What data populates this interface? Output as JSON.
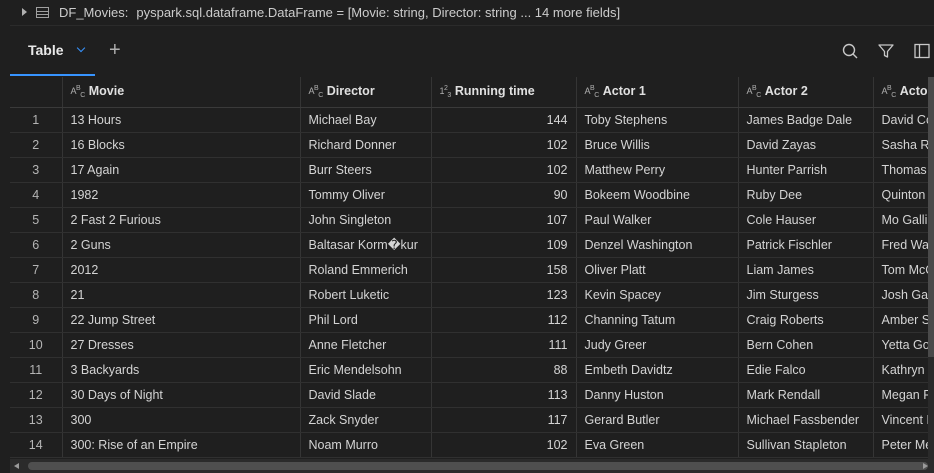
{
  "header": {
    "df_name": "DF_Movies:",
    "df_type": "pyspark.sql.dataframe.DataFrame = [Movie: string, Director: string ... 14 more fields]"
  },
  "tabs": [
    {
      "label": "Table"
    }
  ],
  "toolbar": {
    "icons": [
      "search-icon",
      "filter-icon",
      "panel-icon"
    ]
  },
  "table": {
    "columns": [
      {
        "name": "",
        "type": ""
      },
      {
        "name": "Movie",
        "type": "ABC"
      },
      {
        "name": "Director",
        "type": "ABC"
      },
      {
        "name": "Running time",
        "type": "123"
      },
      {
        "name": "Actor 1",
        "type": "ABC"
      },
      {
        "name": "Actor 2",
        "type": "ABC"
      },
      {
        "name": "Actor",
        "type": "ABC"
      }
    ],
    "rows": [
      [
        "1",
        "13 Hours",
        "Michael Bay",
        "144",
        "Toby Stephens",
        "James Badge Dale",
        "David Co"
      ],
      [
        "2",
        "16 Blocks",
        "Richard Donner",
        "102",
        "Bruce Willis",
        "David Zayas",
        "Sasha Ro"
      ],
      [
        "3",
        "17 Again",
        "Burr Steers",
        "102",
        "Matthew Perry",
        "Hunter Parrish",
        "Thomas L"
      ],
      [
        "4",
        "1982",
        "Tommy Oliver",
        "90",
        "Bokeem Woodbine",
        "Ruby Dee",
        "Quinton A"
      ],
      [
        "5",
        "2 Fast 2 Furious",
        "John Singleton",
        "107",
        "Paul Walker",
        "Cole Hauser",
        "Mo Gallin"
      ],
      [
        "6",
        "2 Guns",
        "Baltasar Korm�kur",
        "109",
        "Denzel Washington",
        "Patrick Fischler",
        "Fred War"
      ],
      [
        "7",
        "2012",
        "Roland Emmerich",
        "158",
        "Oliver Platt",
        "Liam James",
        "Tom McC"
      ],
      [
        "8",
        "21",
        "Robert Luketic",
        "123",
        "Kevin Spacey",
        "Jim Sturgess",
        "Josh Gad"
      ],
      [
        "9",
        "22 Jump Street",
        "Phil Lord",
        "112",
        "Channing Tatum",
        "Craig Roberts",
        "Amber St"
      ],
      [
        "10",
        "27 Dresses",
        "Anne Fletcher",
        "111",
        "Judy Greer",
        "Bern Cohen",
        "Yetta Got"
      ],
      [
        "11",
        "3 Backyards",
        "Eric Mendelsohn",
        "88",
        "Embeth Davidtz",
        "Edie Falco",
        "Kathryn E"
      ],
      [
        "12",
        "30 Days of Night",
        "David Slade",
        "113",
        "Danny Huston",
        "Mark Rendall",
        "Megan Fr"
      ],
      [
        "13",
        "300",
        "Zack Snyder",
        "117",
        "Gerard Butler",
        "Michael Fassbender",
        "Vincent R"
      ],
      [
        "14",
        "300: Rise of an Empire",
        "Noam Murro",
        "102",
        "Eva Green",
        "Sullivan Stapleton",
        "Peter Me"
      ]
    ]
  },
  "colors": {
    "accent": "#3794ff",
    "background": "#1f1f1f",
    "text": "#cccccc"
  }
}
